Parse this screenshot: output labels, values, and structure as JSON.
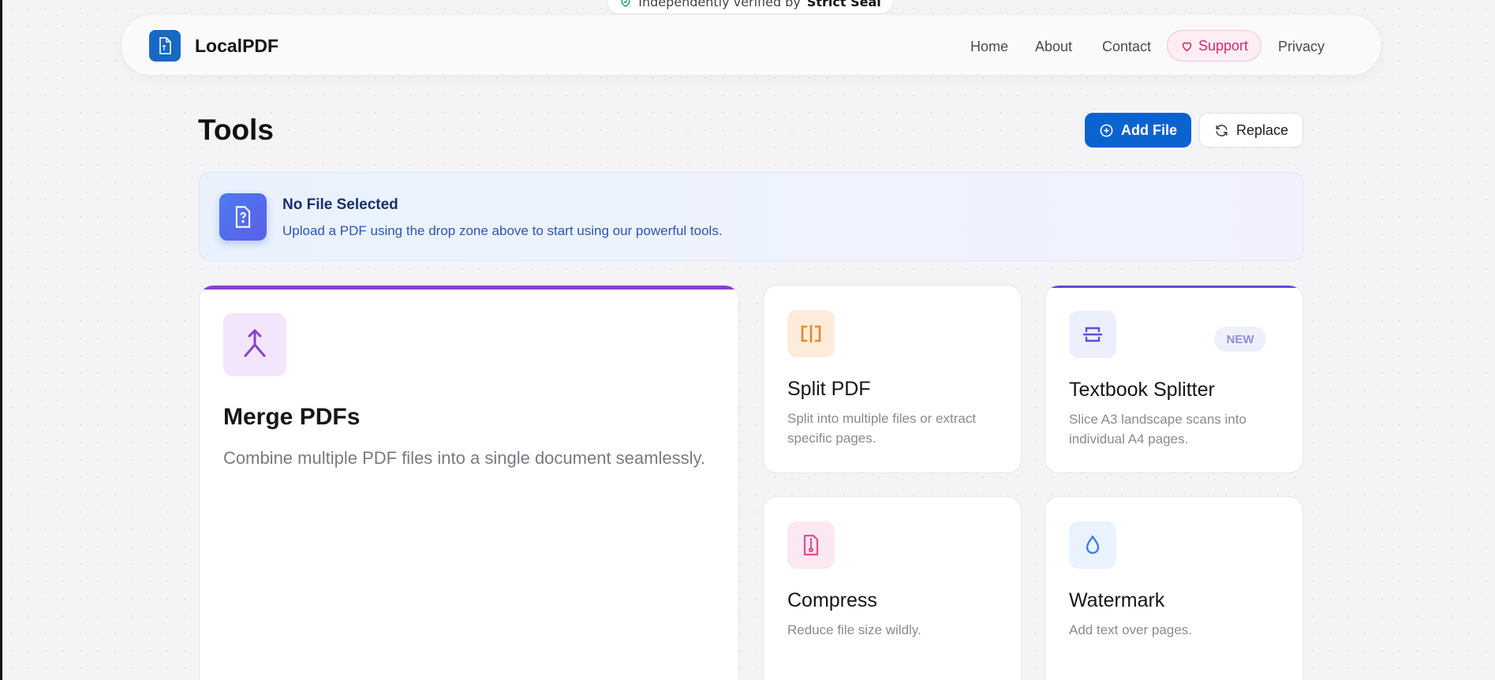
{
  "verification_badge": {
    "prefix": "Independently verified by",
    "brand": "Strict Seal"
  },
  "nav": {
    "logo_text": "LocalPDF",
    "links": [
      "Home",
      "About",
      "Contact",
      "Support",
      "Privacy"
    ]
  },
  "page": {
    "title": "Tools"
  },
  "actions": {
    "add_file": "Add File",
    "replace": "Replace"
  },
  "info": {
    "title": "No File Selected",
    "description": "Upload a PDF using the drop zone above to start using our powerful tools."
  },
  "tools": [
    {
      "title": "Merge PDFs",
      "description": "Combine multiple PDF files into a single document seamlessly.",
      "accent": "#8a3fd1"
    },
    {
      "title": "Split PDF",
      "description_lines": [
        "Split into multiple files or extract",
        "specific pages."
      ],
      "accent": "#e8862a"
    },
    {
      "title": "Textbook Splitter",
      "badge": "NEW",
      "description_lines": [
        "Slice A3 landscape scans into",
        "individual A4 pages."
      ],
      "accent": "#5b4fd6"
    },
    {
      "title": "Compress",
      "description": "Reduce file size wildly.",
      "accent": "#dd4d96"
    },
    {
      "title": "Watermark",
      "description": "Add text over pages.",
      "accent": "#3c7fe0"
    }
  ],
  "colors": {
    "primary": "#0b63cf",
    "support": "#d12a6e",
    "info_title": "#14306e"
  }
}
